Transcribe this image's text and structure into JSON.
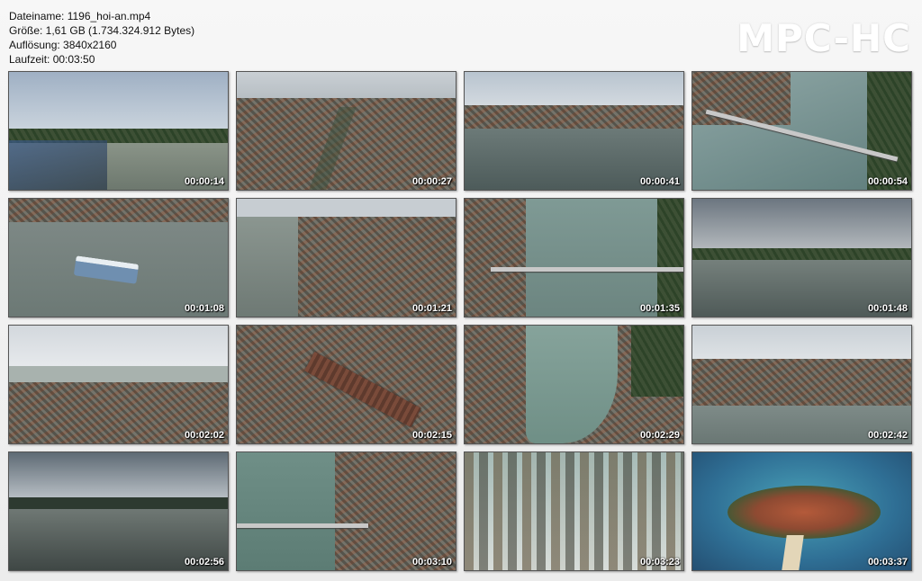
{
  "file_info": {
    "filename_line": "Dateiname: 1196_hoi-an.mp4",
    "size_line": "Größe: 1,61 GB (1.734.324.912 Bytes)",
    "resolution_line": "Auflösung: 3840x2160",
    "duration_line": "Laufzeit: 00:03:50"
  },
  "brand": {
    "text": "MPC-HC"
  },
  "thumbnails": [
    {
      "time": "00:00:14",
      "scene": "river-town-wide"
    },
    {
      "time": "00:00:27",
      "scene": "city-aerial"
    },
    {
      "time": "00:00:41",
      "scene": "waterfront-reflection"
    },
    {
      "time": "00:00:54",
      "scene": "river-bridge"
    },
    {
      "time": "00:01:08",
      "scene": "boat-river"
    },
    {
      "time": "00:01:21",
      "scene": "riverside-street"
    },
    {
      "time": "00:01:35",
      "scene": "bridge-crossing"
    },
    {
      "time": "00:01:48",
      "scene": "river-bend-dusk"
    },
    {
      "time": "00:02:02",
      "scene": "flooded-town"
    },
    {
      "time": "00:02:15",
      "scene": "market-roof"
    },
    {
      "time": "00:02:29",
      "scene": "river-curve-town"
    },
    {
      "time": "00:02:42",
      "scene": "waterfront-panorama"
    },
    {
      "time": "00:02:56",
      "scene": "boats-dusk"
    },
    {
      "time": "00:03:10",
      "scene": "bridge-town-topdown"
    },
    {
      "time": "00:03:23",
      "scene": "skyscrapers"
    },
    {
      "time": "00:03:37",
      "scene": "island-sea"
    }
  ]
}
